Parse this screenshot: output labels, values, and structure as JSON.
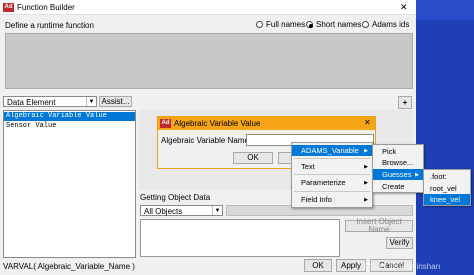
{
  "window": {
    "title": "Function Builder",
    "icon_text": "Ad",
    "close_glyph": "✕"
  },
  "header": {
    "define_label": "Define a runtime function",
    "radio_full": "Full names",
    "radio_short": "Short names",
    "radio_adams": "Adams ids",
    "selected": "Short names"
  },
  "left": {
    "combo_value": "Data Element",
    "assist_label": "Assist...",
    "list": [
      "Algebraic Variable Value",
      "Sensor Value"
    ],
    "selected_index": 0
  },
  "plus_label": "+",
  "getting": {
    "label": "Getting Object Data",
    "combo_value": "All Objects",
    "insert_label": "Insert Object Name",
    "verify_label": "Verify"
  },
  "footer": {
    "expression": "VARVAL( Algebraic_Variable_Name )",
    "ok": "OK",
    "apply": "Apply",
    "cancel": "Cancel",
    "watermark": "CSDN @hkominshan"
  },
  "dialog": {
    "title": "Algebraic Variable Value",
    "icon_text": "Ad",
    "field_label": "Algebraic Variable Name",
    "field_value": "",
    "ok": "OK",
    "close_glyph": "✕"
  },
  "menu1": {
    "items": [
      "ADAMS_Variable",
      "Text",
      "Parameterize",
      "Field Info"
    ],
    "highlighted": 0
  },
  "menu2": {
    "items": [
      "Pick",
      "Browse...",
      "Guesses",
      "Create"
    ],
    "highlighted": 2
  },
  "menu3": {
    "items": [
      ".foot:",
      "root_vel",
      "knee_vel"
    ],
    "highlighted": 2
  },
  "colors": {
    "highlight": "#0078d7",
    "dialog_border": "#f0a020",
    "background": "#1e3fb6"
  }
}
